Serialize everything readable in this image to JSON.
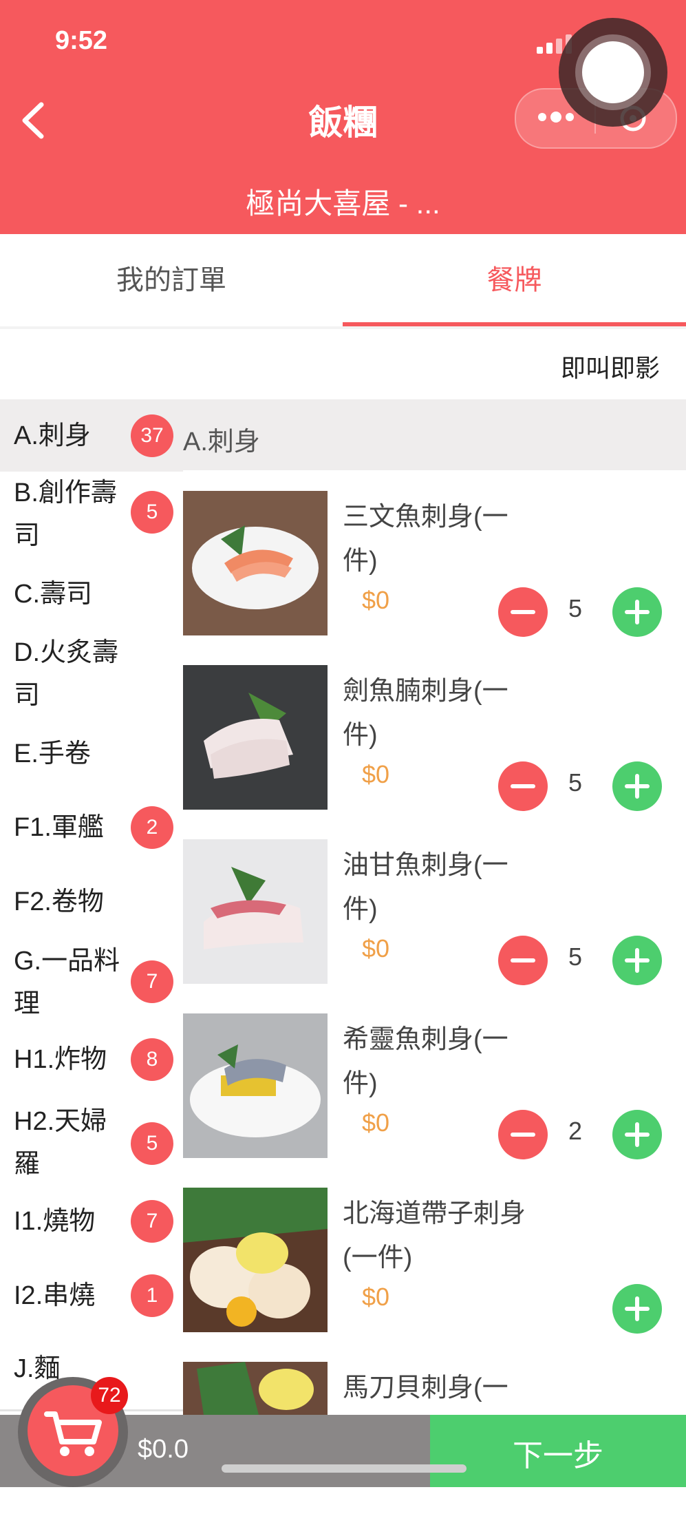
{
  "status_bar": {
    "time": "9:52"
  },
  "header": {
    "title": "飯糰",
    "subtitle": "極尚大喜屋 - ..."
  },
  "tabs": [
    {
      "label": "我的訂單",
      "active": false
    },
    {
      "label": "餐牌",
      "active": true
    }
  ],
  "instant_label": "即叫即影",
  "categories": [
    {
      "label": "A.刺身",
      "badge": "37",
      "active": true
    },
    {
      "label": "B.創作壽司",
      "badge": "5"
    },
    {
      "label": "C.壽司",
      "badge": ""
    },
    {
      "label": "D.火炙壽司",
      "badge": ""
    },
    {
      "label": "E.手卷",
      "badge": ""
    },
    {
      "label": "F1.軍艦",
      "badge": "2"
    },
    {
      "label": "F2.卷物",
      "badge": ""
    },
    {
      "label": "G.一品料理",
      "badge": "7"
    },
    {
      "label": "H1.炸物",
      "badge": "8"
    },
    {
      "label": "H2.天婦羅",
      "badge": "5"
    },
    {
      "label": "I1.燒物",
      "badge": "7"
    },
    {
      "label": "I2.串燒",
      "badge": "1"
    },
    {
      "label": "J.麵",
      "badge": ""
    }
  ],
  "section_title": "A.刺身",
  "items": [
    {
      "name": "三文魚刺身(一件)",
      "price": "$0",
      "qty": "5"
    },
    {
      "name": "劍魚腩刺身(一件)",
      "price": "$0",
      "qty": "5"
    },
    {
      "name": "油甘魚刺身(一件)",
      "price": "$0",
      "qty": "5"
    },
    {
      "name": "希靈魚刺身(一件)",
      "price": "$0",
      "qty": "2"
    },
    {
      "name": "北海道帶子刺身(一件)",
      "price": "$0",
      "qty": ""
    },
    {
      "name": "馬刀貝刺身(一",
      "price": "",
      "qty": ""
    }
  ],
  "cart": {
    "count": "72",
    "total": "$0.0"
  },
  "next_label": "下一步",
  "colors": {
    "brand": "#f6595d",
    "accent_green": "#4dce6e",
    "price": "#f0a048"
  }
}
